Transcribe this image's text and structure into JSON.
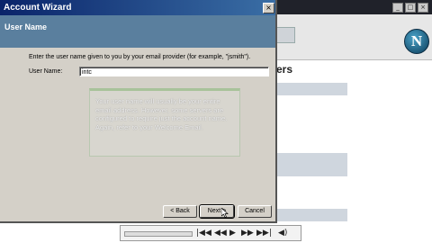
{
  "background_app": {
    "heading_fragment": "ers",
    "logo_letter": "N",
    "window_controls": [
      "_",
      "□",
      "×"
    ]
  },
  "dialog": {
    "title": "Account Wizard",
    "close_symbol": "×",
    "section_header": "User Name",
    "instruction": "Enter the user name given to you by your email provider (for example, \"jsmith\").",
    "user_name_label": "User Name:",
    "user_name_value": "intc",
    "tooltip_text": "Your user name will usually be your entire email address. However, some servers are configured to require just the account name. Again, refer to your Welcome Email.",
    "buttons": {
      "back": "< Back",
      "next": "Next >",
      "cancel": "Cancel"
    }
  },
  "player_controls": [
    "|◀◀",
    "◀◀",
    "▶",
    "▶▶",
    "▶▶|",
    "◀)"
  ],
  "colors": {
    "title_bar": "#0a246a",
    "header_band": "#5a7f9e",
    "dialog_face": "#d4d0c8",
    "tooltip_band": "#a8c29a"
  }
}
